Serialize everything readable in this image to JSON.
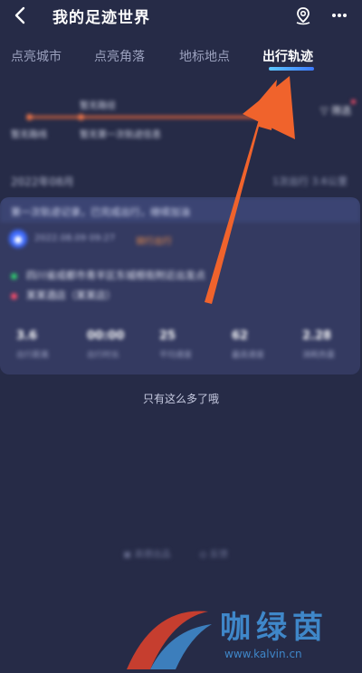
{
  "header": {
    "title": "我的足迹世界",
    "back_icon": "chevron-left-icon",
    "map_pin_icon": "location-pin-icon",
    "more_icon": "more-dots-icon"
  },
  "tabs": [
    {
      "label": "点亮城市",
      "active": false
    },
    {
      "label": "点亮角落",
      "active": false
    },
    {
      "label": "地标地点",
      "active": false
    },
    {
      "label": "出行轨迹",
      "active": true
    }
  ],
  "timeline": {
    "top_label": "暂无路径",
    "left_label": "暂无路线",
    "mid_label": "暂无第一次轨迹信息",
    "filter_label": "筛选"
  },
  "month": {
    "label": "2022年08月",
    "summary": "1次出行 3.6公里"
  },
  "trip_card": {
    "banner": "第一次轨迹记录，已完成出行，继续加油",
    "time": "2022.08.09 09:27",
    "tag": "骑行出行",
    "start_location": "四川省成都市青羊区东城根街附近出发点",
    "end_location": "某某酒店（某某店）",
    "stats": [
      {
        "value": "3.6",
        "label": "出行距离"
      },
      {
        "value": "00:00",
        "label": "出行时长"
      },
      {
        "value": "25",
        "label": "平均速度"
      },
      {
        "value": "62",
        "label": "最高速度"
      },
      {
        "value": "2.28",
        "label": "消耗热量"
      }
    ]
  },
  "end_text": "只有这么多了哦",
  "footer": {
    "left_link": "高德出品",
    "right_link": "反馈"
  },
  "watermark": {
    "text": "咖绿茵",
    "url": "www.kalvin.cn"
  },
  "colors": {
    "background": "#262b47",
    "arrow": "#f0632c",
    "accent": "#3c79ff"
  }
}
